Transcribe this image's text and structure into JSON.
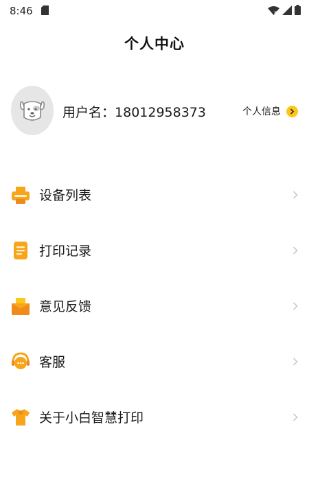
{
  "status_bar": {
    "time": "8:46",
    "icons": [
      "sd-card-icon",
      "wifi-icon",
      "signal-icon",
      "battery-icon"
    ]
  },
  "header": {
    "title": "个人中心"
  },
  "profile": {
    "username_label": "用户名：",
    "username_value": "18012958373",
    "info_link": "个人信息",
    "avatar_icon": "dog-avatar-icon"
  },
  "menu": {
    "items": [
      {
        "label": "设备列表",
        "icon": "printer-icon"
      },
      {
        "label": "打印记录",
        "icon": "document-icon"
      },
      {
        "label": "意见反馈",
        "icon": "feedback-box-icon"
      },
      {
        "label": "客服",
        "icon": "headset-icon"
      },
      {
        "label": "关于小白智慧打印",
        "icon": "shirt-icon"
      }
    ]
  },
  "colors": {
    "accent": "#ffc61a",
    "icon_orange": "#f7a51a",
    "icon_deep_orange": "#f08a1c",
    "chevron": "#c4c4c4"
  }
}
